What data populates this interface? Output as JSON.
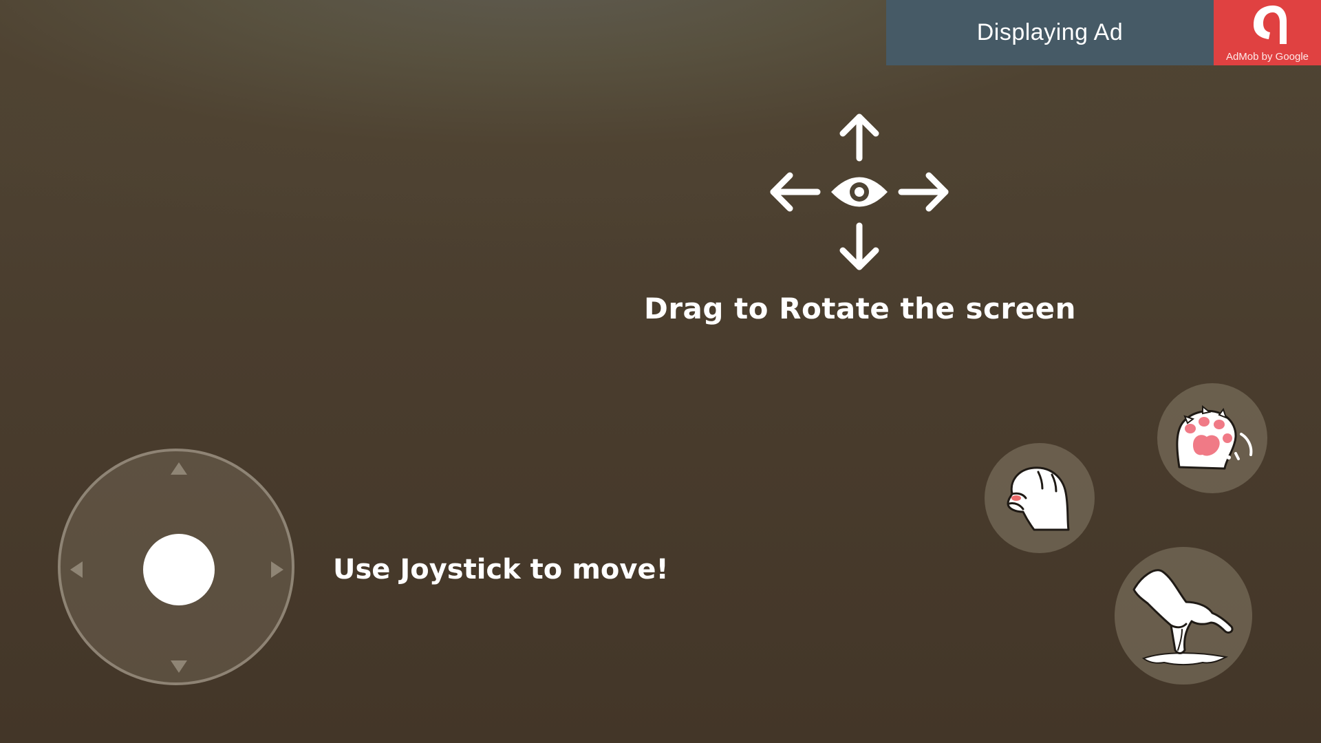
{
  "ad": {
    "text": "Displaying Ad",
    "badge_caption": "AdMob by Google",
    "panel_color": "#465a66",
    "badge_color": "#e04141"
  },
  "hints": {
    "rotate": "Drag to Rotate the screen",
    "joystick": "Use Joystick to move!"
  },
  "icons": {
    "rotate": "eye-with-four-arrows-icon",
    "joystick_arrows": [
      "up",
      "down",
      "left",
      "right"
    ],
    "scratch_button": "cat-paw-scratch-icon",
    "paw_button": "cat-paw-pads-icon",
    "jump_button": "cat-leg-jump-icon"
  }
}
